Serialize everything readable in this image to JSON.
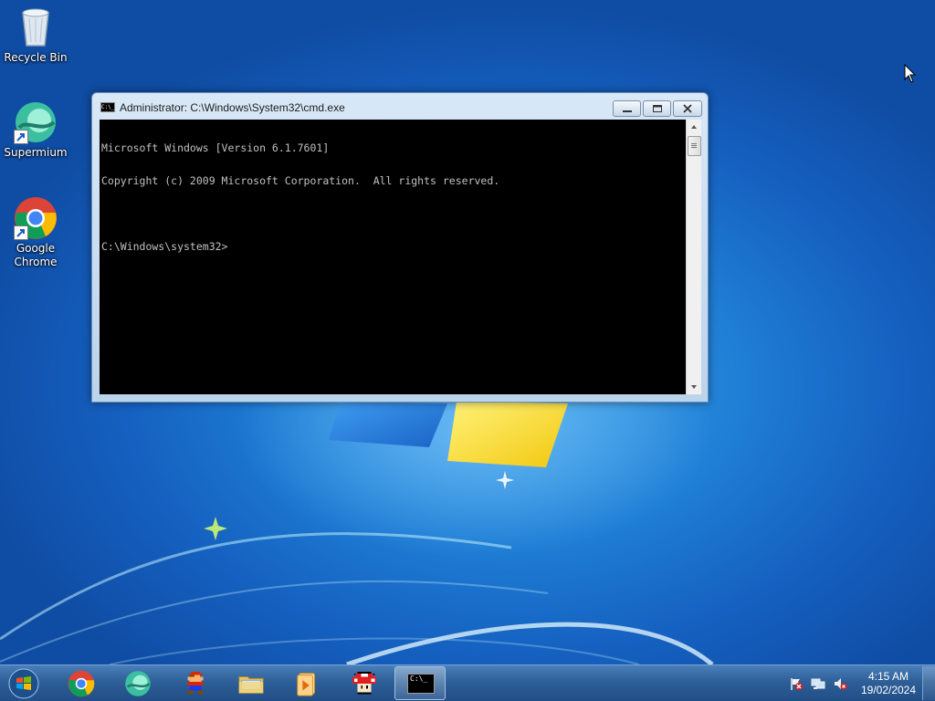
{
  "desktop": {
    "icons": [
      {
        "label": "Recycle Bin",
        "icon": "recycle-bin-icon"
      },
      {
        "label": "Supermium",
        "icon": "supermium-icon"
      },
      {
        "label": "Google Chrome",
        "icon": "chrome-icon"
      }
    ]
  },
  "window": {
    "title": "Administrator: C:\\Windows\\System32\\cmd.exe",
    "title_icon_text": "C:\\_",
    "console_lines": [
      "Microsoft Windows [Version 6.1.7601]",
      "Copyright (c) 2009 Microsoft Corporation.  All rights reserved.",
      "",
      "C:\\Windows\\system32>"
    ],
    "buttons": {
      "minimize": "minimize-icon",
      "maximize": "maximize-icon",
      "close": "close-icon"
    }
  },
  "taskbar": {
    "items": [
      "start-orb-icon",
      "chrome-icon",
      "supermium-icon",
      "mario-game-icon",
      "file-explorer-icon",
      "media-player-icon",
      "mushroom-game-icon",
      "cmd-icon"
    ],
    "active_item": "cmd-icon",
    "cmd_icon_text": "C:\\_",
    "tray": {
      "icons": [
        "action-center-flag-icon",
        "network-icon",
        "volume-muted-icon"
      ],
      "time": "4:15 AM",
      "date": "19/02/2024"
    }
  },
  "colors": {
    "console_bg": "#000000",
    "console_fg": "#c0c0c0",
    "desktop_blue": "#1f7fd6",
    "taskbar": "#2e5f98"
  }
}
